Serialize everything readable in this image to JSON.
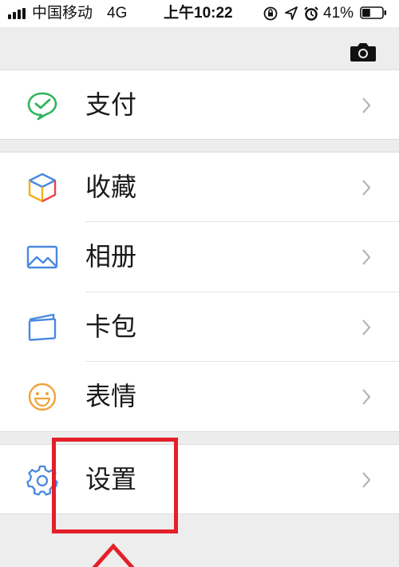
{
  "status_bar": {
    "carrier": "中国移动",
    "network": "4G",
    "time": "上午10:22",
    "battery_percent": "41%",
    "battery_level": 0.41,
    "icons": [
      "signal-icon",
      "orientation-lock-icon",
      "location-icon",
      "alarm-icon",
      "battery-icon"
    ]
  },
  "header": {
    "icons": [
      "camera-icon"
    ]
  },
  "menu": {
    "groups": [
      {
        "items": [
          {
            "label": "支付",
            "icon": "wechat-pay-icon"
          }
        ]
      },
      {
        "items": [
          {
            "label": "收藏",
            "icon": "favorites-cube-icon"
          },
          {
            "label": "相册",
            "icon": "album-image-icon"
          },
          {
            "label": "卡包",
            "icon": "card-wallet-icon"
          },
          {
            "label": "表情",
            "icon": "emoji-smiley-icon"
          }
        ]
      },
      {
        "items": [
          {
            "label": "设置",
            "icon": "settings-gear-icon"
          }
        ]
      }
    ]
  },
  "colors": {
    "background": "#ededed",
    "surface": "#ffffff",
    "pay_green": "#2fb55d",
    "icon_blue": "#4a88e0",
    "emoji_orange": "#f0a23a",
    "annotation_red": "#e41f2a"
  },
  "annotation": {
    "target": "设置"
  }
}
